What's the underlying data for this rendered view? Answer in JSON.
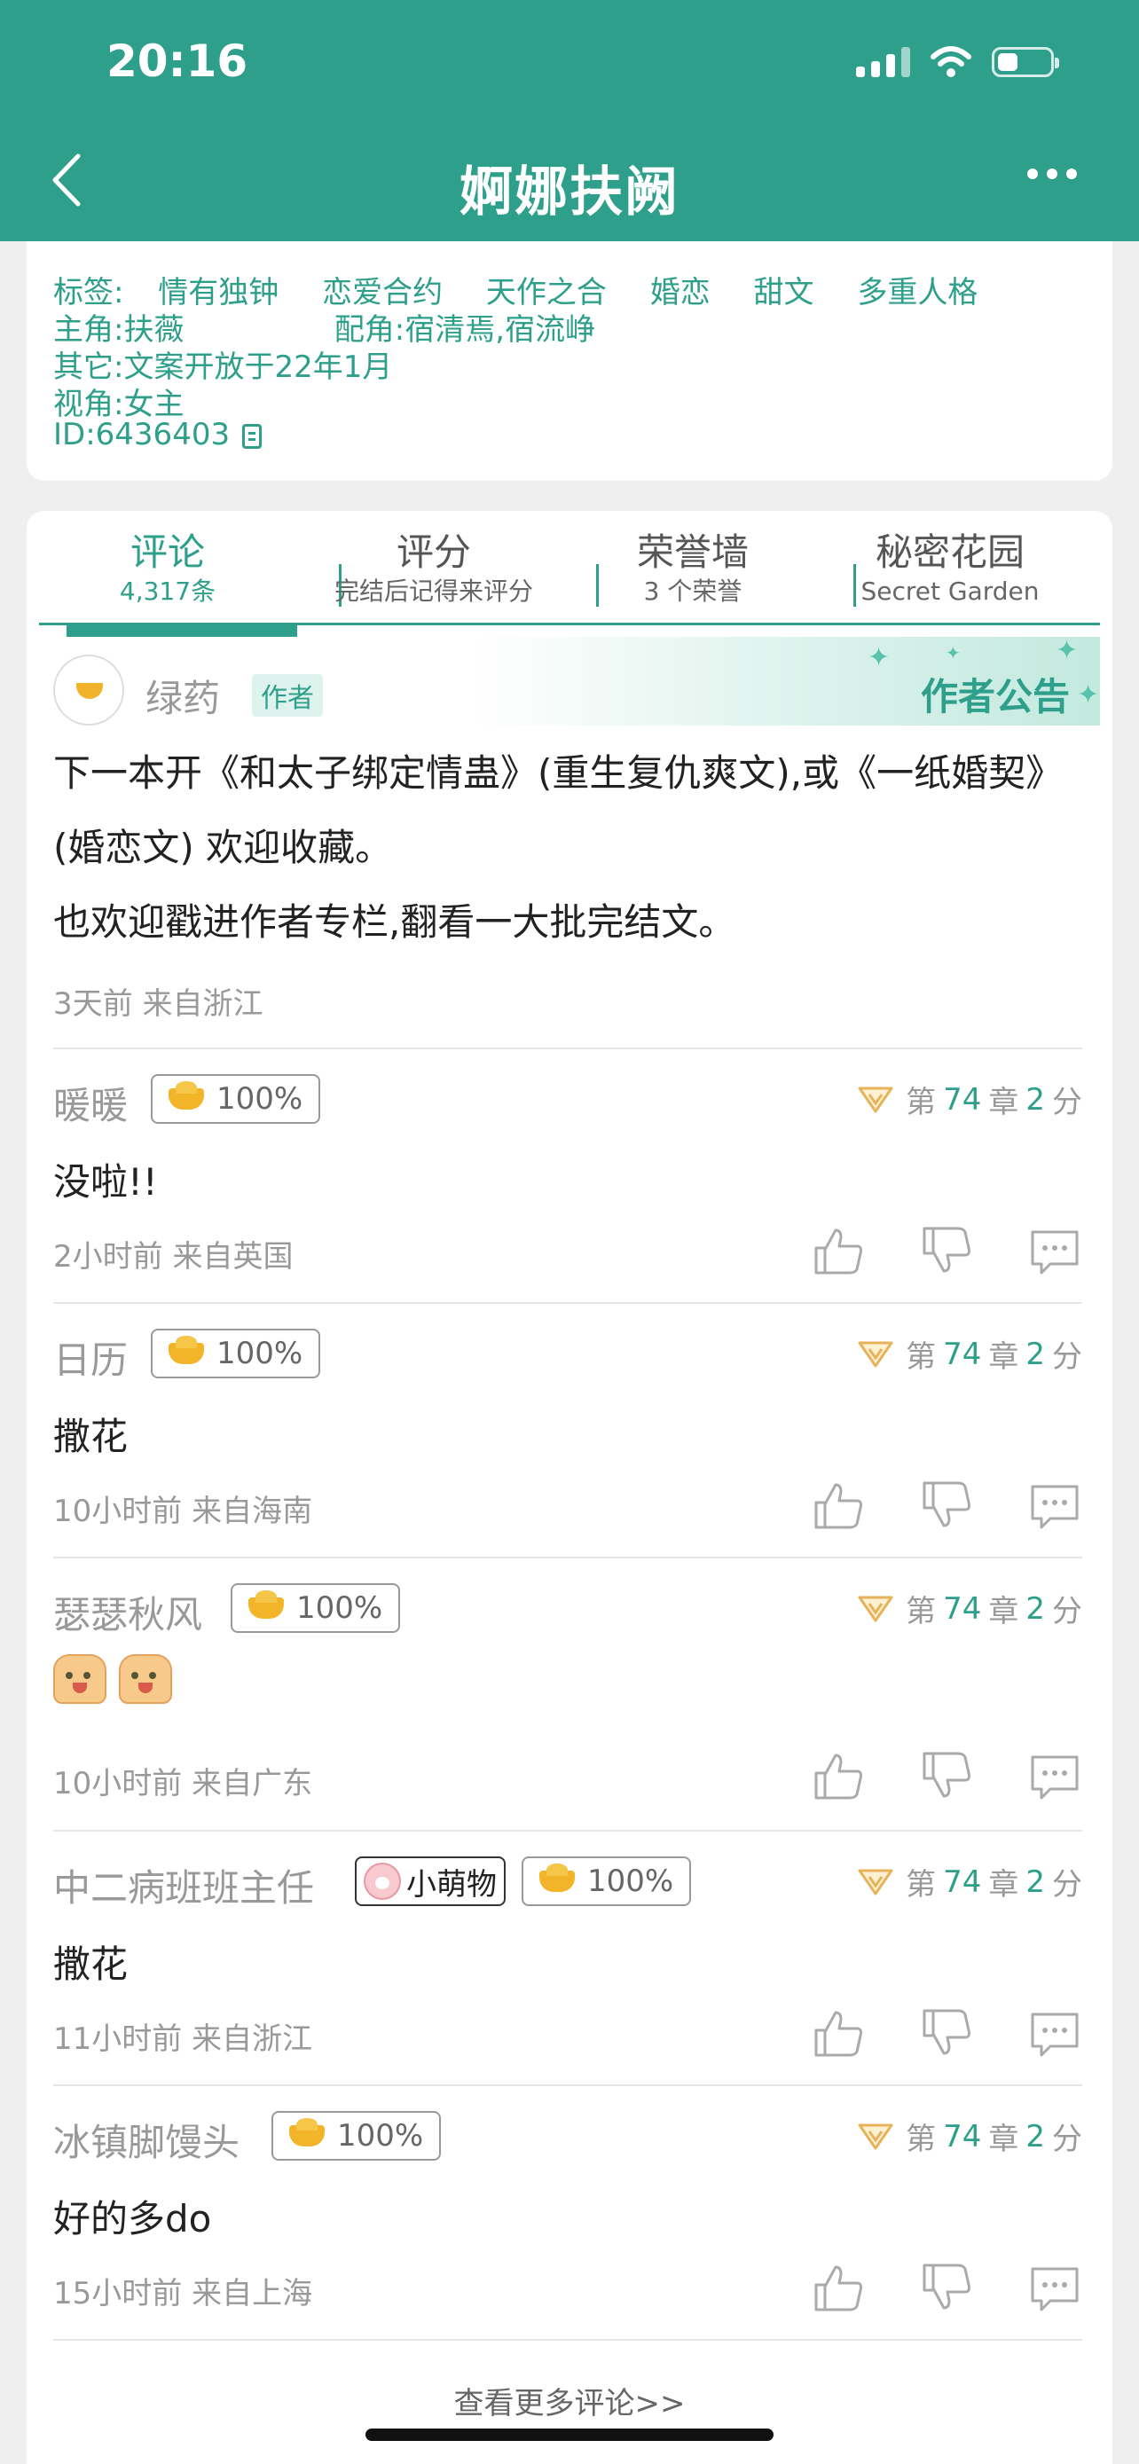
{
  "status_bar": {
    "time": "20:16"
  },
  "nav": {
    "title": "婀娜扶阙"
  },
  "info": {
    "tags_label": "标签:",
    "tags": [
      "情有独钟",
      "恋爱合约",
      "天作之合",
      "婚恋",
      "甜文",
      "多重人格"
    ],
    "protagonist": "主角:扶薇",
    "supporting": "配角:宿清焉,宿流峥",
    "other": "其它:文案开放于22年1月",
    "pov": "视角:女主",
    "id": "ID:6436403"
  },
  "tabs": [
    {
      "label": "评论",
      "sub": "4,317条"
    },
    {
      "label": "评分",
      "sub": "完结后记得来评分"
    },
    {
      "label": "荣誉墙",
      "sub": "3 个荣誉"
    },
    {
      "label": "秘密花园",
      "sub": "Secret Garden"
    }
  ],
  "announcement": {
    "author": "绿药",
    "author_tag": "作者",
    "label": "作者公告",
    "text": "下一本开《和太子绑定情蛊》(重生复仇爽文),或《一纸婚契》(婚恋文) 欢迎收藏。",
    "text2": "也欢迎戳进作者专栏,翻看一大批完结文。",
    "meta": "3天前  来自浙江"
  },
  "comments": [
    {
      "name": "暖暖",
      "badge": "100%",
      "chapter_prefix": "第",
      "chapter": "74",
      "chapter_unit": "章",
      "score": "2",
      "score_unit": "分",
      "text": "没啦!!",
      "meta": "2小时前  来自英国"
    },
    {
      "name": "日历",
      "badge": "100%",
      "chapter_prefix": "第",
      "chapter": "74",
      "chapter_unit": "章",
      "score": "2",
      "score_unit": "分",
      "text": "撒花",
      "meta": "10小时前  来自海南"
    },
    {
      "name": "瑟瑟秋风",
      "badge": "100%",
      "chapter_prefix": "第",
      "chapter": "74",
      "chapter_unit": "章",
      "score": "2",
      "score_unit": "分",
      "text": "",
      "meta": "10小时前  来自广东"
    },
    {
      "name": "中二病班班主任",
      "extra_badge": "小萌物",
      "badge": "100%",
      "chapter_prefix": "第",
      "chapter": "74",
      "chapter_unit": "章",
      "score": "2",
      "score_unit": "分",
      "text": "撒花",
      "meta": "11小时前  来自浙江"
    },
    {
      "name": "冰镇脚馒头",
      "badge": "100%",
      "chapter_prefix": "第",
      "chapter": "74",
      "chapter_unit": "章",
      "score": "2",
      "score_unit": "分",
      "text": "好的多do",
      "meta": "15小时前  来自上海"
    }
  ],
  "more_link": "查看更多评论>>"
}
